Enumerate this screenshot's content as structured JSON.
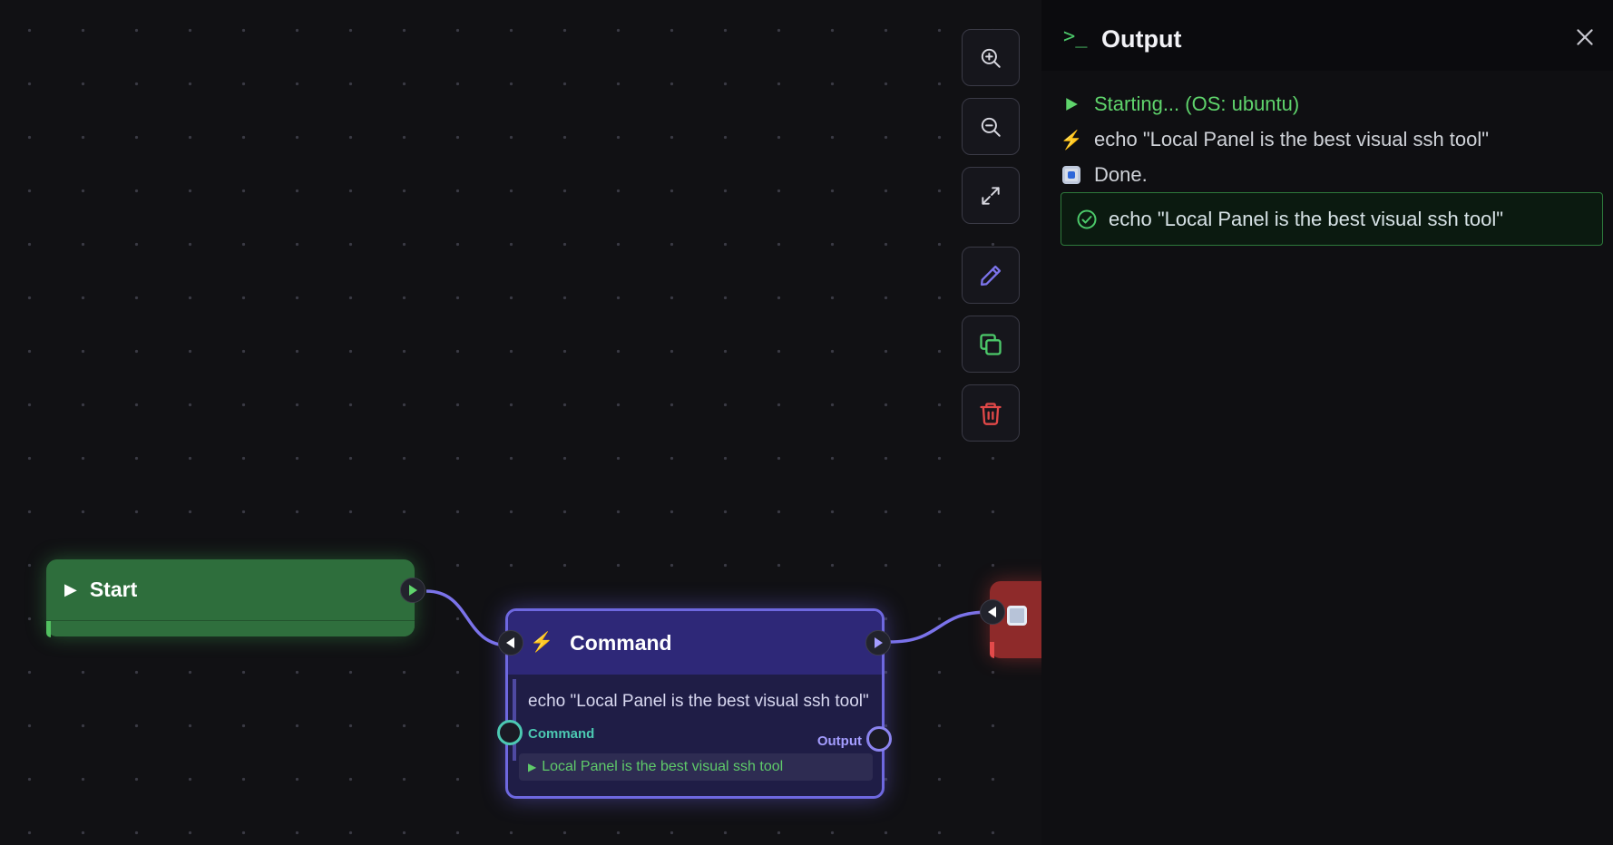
{
  "canvas": {
    "start_node": {
      "title": "Start",
      "icon": "play-icon"
    },
    "command_node": {
      "title": "Command",
      "icon": "lightning-icon",
      "command_text": "echo \"Local Panel is the best visual ssh tool\"",
      "input_port_label": "Command",
      "output_port_label": "Output",
      "result_text": "Local Panel is the best visual ssh tool"
    },
    "stop_node": {
      "icon": "stop-icon"
    },
    "toolbar": {
      "zoom_in": "zoom-in-icon",
      "zoom_out": "zoom-out-icon",
      "fit_view": "expand-icon",
      "edit": "pencil-icon",
      "duplicate": "copy-icon",
      "delete": "trash-icon"
    }
  },
  "output_panel": {
    "title": "Output",
    "lines": [
      {
        "icon": "play-icon",
        "text": "Starting... (OS: ubuntu)"
      },
      {
        "icon": "lightning-icon",
        "text": "echo \"Local Panel is the best visual ssh tool\""
      },
      {
        "icon": "stop-icon",
        "text": "Done."
      }
    ],
    "result": {
      "icon": "check-circle-icon",
      "text": "echo \"Local Panel is the best visual ssh tool\""
    }
  },
  "colors": {
    "start_node": "#2e6e3c",
    "command_node": "#2e2878",
    "command_border": "#6e68e0",
    "stop_node": "#8e2a2a",
    "success": "#5fd46c",
    "delete": "#e04848",
    "edit": "#7b73ea",
    "copy": "#4cc96a"
  }
}
